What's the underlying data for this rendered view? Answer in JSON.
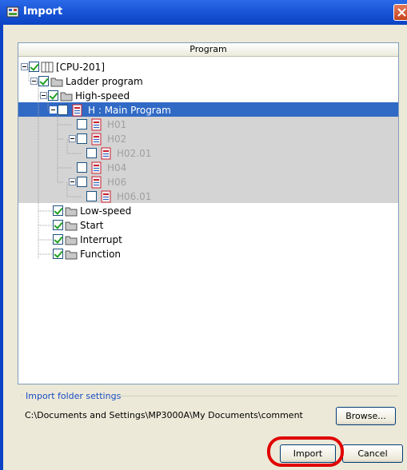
{
  "window": {
    "title": "Import"
  },
  "tree": {
    "column_header": "Program",
    "rows": [
      {
        "label": "[CPU-201]",
        "checked": true,
        "icon": "cpu-icon"
      },
      {
        "label": "Ladder program",
        "checked": true,
        "icon": "folder-icon"
      },
      {
        "label": "High-speed",
        "checked": true,
        "icon": "folder-icon"
      },
      {
        "label": "H : Main Program",
        "checked": false,
        "icon": "program-icon",
        "selected": true
      },
      {
        "label": "H01",
        "checked": false,
        "icon": "program-icon"
      },
      {
        "label": "H02",
        "checked": false,
        "icon": "program-icon"
      },
      {
        "label": "H02.01",
        "checked": false,
        "icon": "program-icon"
      },
      {
        "label": "H04",
        "checked": false,
        "icon": "program-icon"
      },
      {
        "label": "H06",
        "checked": false,
        "icon": "program-icon"
      },
      {
        "label": "H06.01",
        "checked": false,
        "icon": "program-icon"
      },
      {
        "label": "Low-speed",
        "checked": true,
        "icon": "folder-icon"
      },
      {
        "label": "Start",
        "checked": true,
        "icon": "folder-icon"
      },
      {
        "label": "Interrupt",
        "checked": true,
        "icon": "folder-icon"
      },
      {
        "label": "Function",
        "checked": true,
        "icon": "folder-icon"
      }
    ]
  },
  "import_folder": {
    "group_label": "Import folder settings",
    "path": "C:\\Documents and Settings\\MP3000A\\My Documents\\comment",
    "browse_label": "Browse..."
  },
  "buttons": {
    "import_label": "Import",
    "cancel_label": "Cancel"
  },
  "colors": {
    "titlebar": "#0b43c4",
    "selection": "#316ac5",
    "highlight": "#e00000",
    "checkmark": "#21a121"
  }
}
